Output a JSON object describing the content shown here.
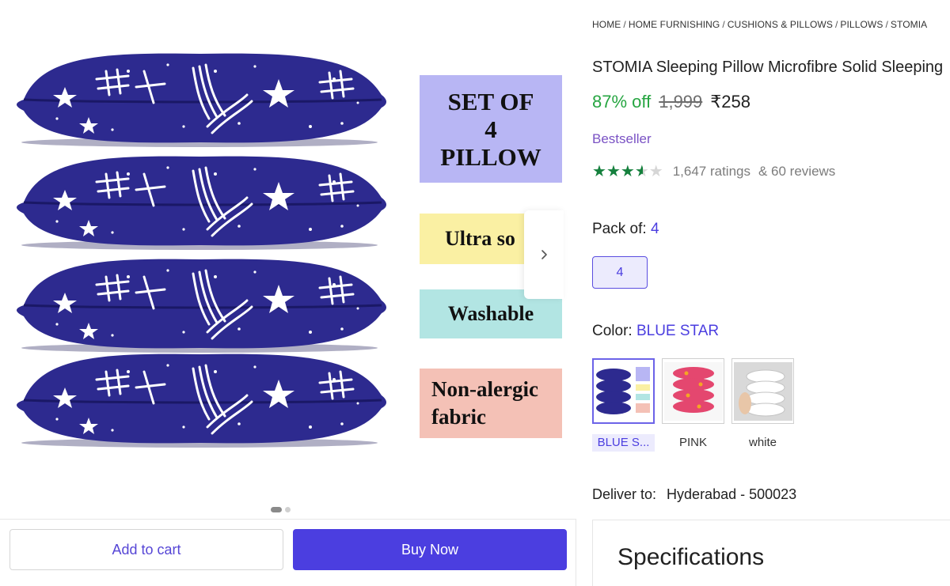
{
  "gallery": {
    "feature_cards": {
      "set_of": "SET OF",
      "set_count": "4",
      "set_item": "PILLOW",
      "soft": "Ultra so",
      "washable": "Washable",
      "nonalergic_line1": "Non-alergic",
      "nonalergic_line2": "fabric"
    },
    "next_icon": "chevron-right-icon",
    "carousel": {
      "current_slide": 1,
      "total_slides": 2
    },
    "colors": {
      "pillow_blue": "#2d2a8f",
      "card_purple": "#b8b6f4",
      "card_yellow": "#faf0a3",
      "card_cyan": "#b2e5e3",
      "card_pink": "#f4c1b6"
    }
  },
  "actions": {
    "add_to_cart": "Add to cart",
    "buy_now": "Buy Now",
    "buy_color": "#4b3ee0"
  },
  "breadcrumb": [
    "HOME",
    "HOME FURNISHING",
    "CUSHIONS & PILLOWS",
    "PILLOWS",
    "STOMIA"
  ],
  "product": {
    "title": "STOMIA Sleeping Pillow Microfibre Solid Sleeping",
    "discount": "87% off",
    "mrp": "1,999",
    "price": "₹258",
    "badge": "Bestseller",
    "rating_value": 3.5,
    "rating_max": 5,
    "ratings_text": "1,647 ratings",
    "reviews_text": "& 60 reviews"
  },
  "pack": {
    "label": "Pack of:",
    "value": "4",
    "options": [
      "4"
    ]
  },
  "color": {
    "label": "Color:",
    "value": "BLUE STAR",
    "options": [
      {
        "label": "BLUE S...",
        "selected": true
      },
      {
        "label": "PINK",
        "selected": false
      },
      {
        "label": "white",
        "selected": false
      }
    ]
  },
  "delivery": {
    "label": "Deliver to:",
    "location": "Hyderabad - 500023"
  },
  "specifications": {
    "title": "Specifications"
  }
}
